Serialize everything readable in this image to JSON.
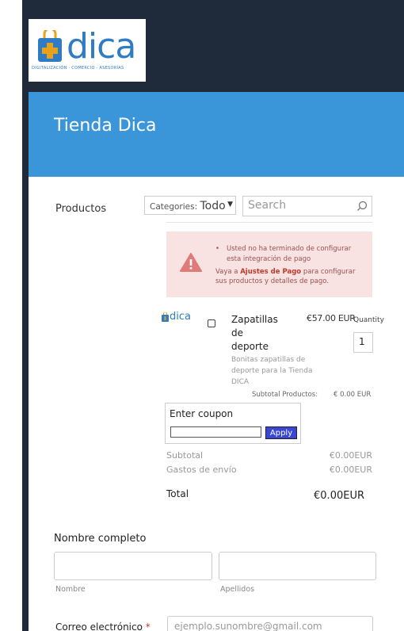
{
  "brand": {
    "logo_text": "dica",
    "logo_tagline": "DIGITALIZACIÓN · COMERCIO · ASESORÍAS"
  },
  "header": {
    "title": "Tienda Dica"
  },
  "products": {
    "label": "Productos",
    "category_prefix": "Categories:",
    "category_value": "Todo",
    "search_placeholder": "Search"
  },
  "alert": {
    "line1": "Usted no ha terminado de configurar",
    "line2": "esta integración de pago",
    "line3_pre": "Vaya a",
    "line3_link": "Ajustes de Pago",
    "line3_post": "para configurar",
    "line4": "sus productos y detalles de pago."
  },
  "product": {
    "logo_text": "dica",
    "name_lines": [
      "Zapatillas",
      "de",
      "deporte"
    ],
    "price": "€57.00 EUR",
    "quantity_label": "Quantity",
    "quantity_value": "1",
    "description_lines": [
      "Bonitas zapatillas de",
      "deporte para la Tienda",
      "DICA"
    ],
    "subtotal_label": "Subtotal Productos:",
    "subtotal_value": "€ 0.00 EUR"
  },
  "coupon": {
    "label": "Enter coupon",
    "apply": "Apply"
  },
  "summary": {
    "subtotal_label": "Subtotal",
    "subtotal_value": "€0.00EUR",
    "shipping_label": "Gastos de envío",
    "shipping_value": "€0.00EUR",
    "total_label": "Total",
    "total_value": "€0.00EUR"
  },
  "form": {
    "full_name_label": "Nombre completo",
    "first_name_hint": "Nombre",
    "last_name_hint": "Apellidos",
    "email_label": "Correo electrónico",
    "required_mark": "*",
    "email_placeholder": "ejemplo.sunombre@gmail.com"
  },
  "colors": {
    "banner": "#3b96d9",
    "frame": "#1f2b3a",
    "alert_bg": "#f9e2e2",
    "apply": "#3a47d5"
  }
}
